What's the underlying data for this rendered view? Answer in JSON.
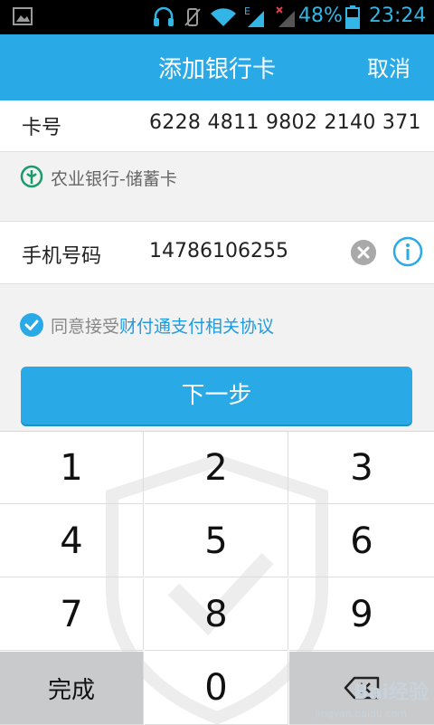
{
  "status_bar": {
    "battery_percent": "48%",
    "time": "23:24",
    "network_label": "E",
    "icons": [
      "screenshot-icon",
      "headset-icon",
      "vibrate-off-icon",
      "wifi-icon",
      "signal-e-icon",
      "signal-no-service-icon",
      "battery-icon"
    ]
  },
  "header": {
    "title": "添加银行卡",
    "cancel_label": "取消"
  },
  "card": {
    "label": "卡号",
    "number": "6228 4811 9802 2140 371"
  },
  "bank": {
    "name": "农业银行-储蓄卡",
    "icon": "abc-bank-logo-icon"
  },
  "phone": {
    "label": "手机号码",
    "number": "14786106255"
  },
  "agreement": {
    "prefix": "同意接受",
    "link": "财付通支付相关协议",
    "checked": true
  },
  "next_button": {
    "label": "下一步"
  },
  "keypad": {
    "keys": [
      "1",
      "2",
      "3",
      "4",
      "5",
      "6",
      "7",
      "8",
      "9"
    ],
    "done_label": "完成",
    "zero": "0",
    "delete_icon": "backspace-icon"
  },
  "watermark": {
    "text": "Bai经验",
    "sub": "jingyan.baidu.com"
  },
  "colors": {
    "accent": "#29a9e6",
    "link": "#1f9be0",
    "status_blue": "#33b5e5"
  }
}
